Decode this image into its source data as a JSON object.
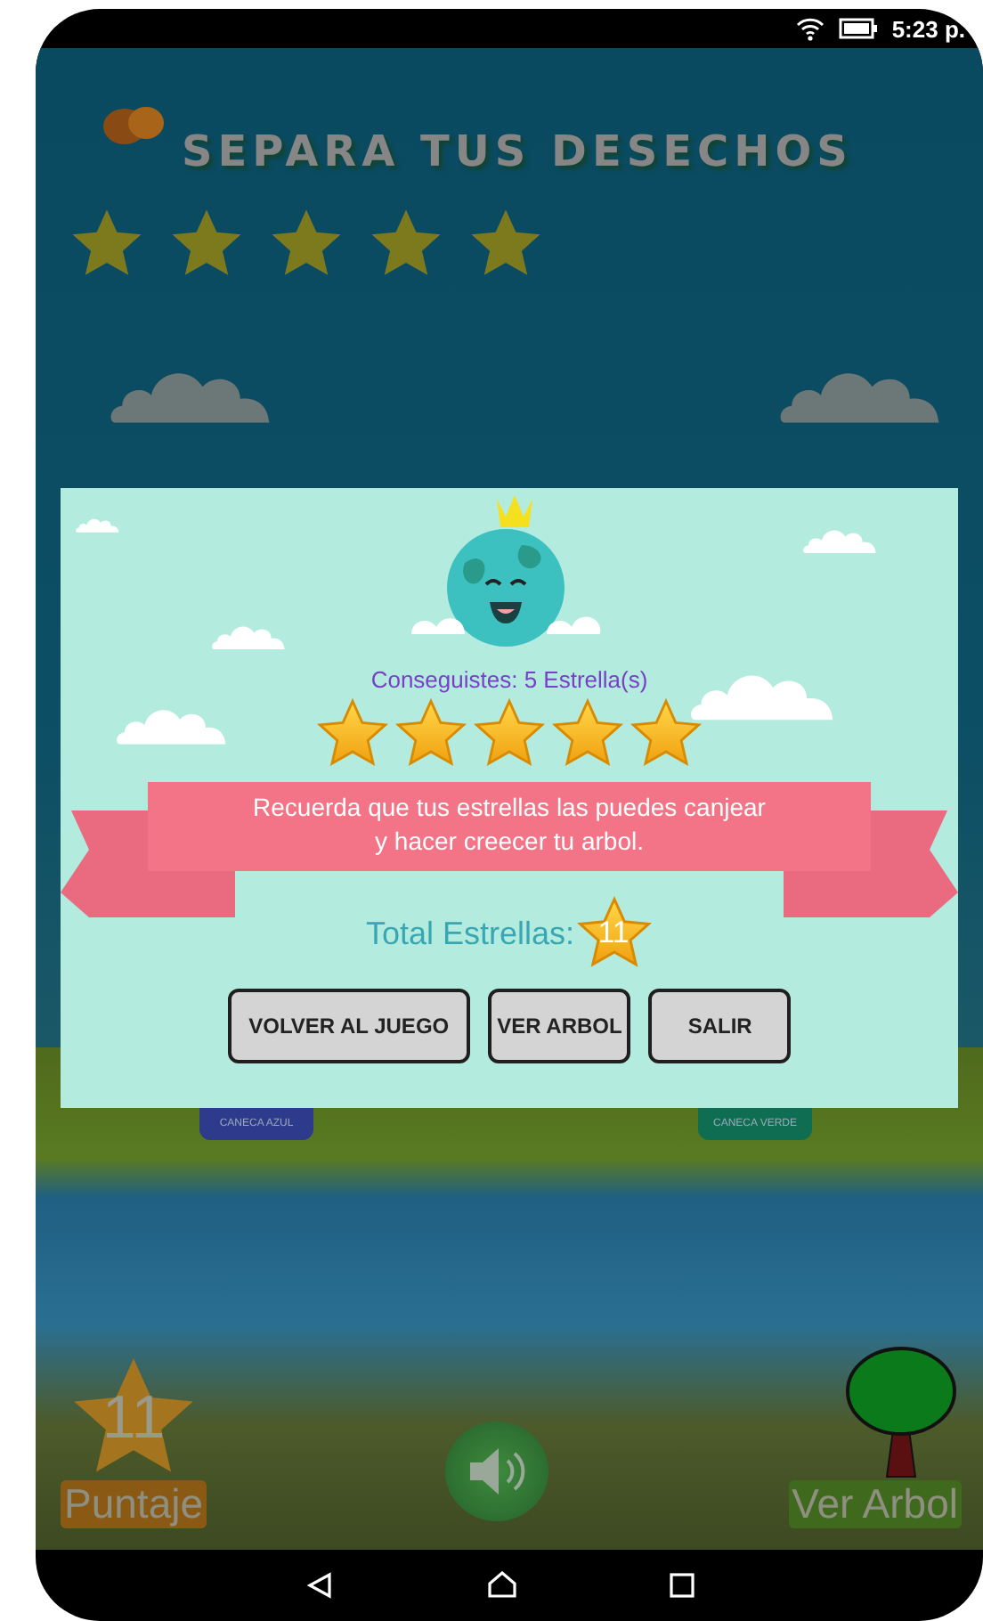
{
  "status_bar": {
    "time": "5:23 p."
  },
  "game": {
    "title": "SEPARA TUS DESECHOS",
    "stars": 5,
    "bins": [
      {
        "label": "CANECA AZUL",
        "color": "#2e3a8c"
      },
      {
        "label": "CANECA VERDE",
        "color": "#0f6e52"
      }
    ],
    "score": {
      "value": "11",
      "label": "Puntaje"
    },
    "tree_button": {
      "label": "Ver Arbol"
    }
  },
  "dialog": {
    "earned": "Conseguistes: 5 Estrella(s)",
    "stars": 5,
    "banner_lines": [
      "Recuerda que tus estrellas las puedes canjear",
      "y hacer creecer tu arbol."
    ],
    "total_label": "Total Estrellas:",
    "total_value": "11",
    "buttons": [
      "VOLVER AL JUEGO",
      "VER ARBOL",
      "SALIR"
    ]
  }
}
